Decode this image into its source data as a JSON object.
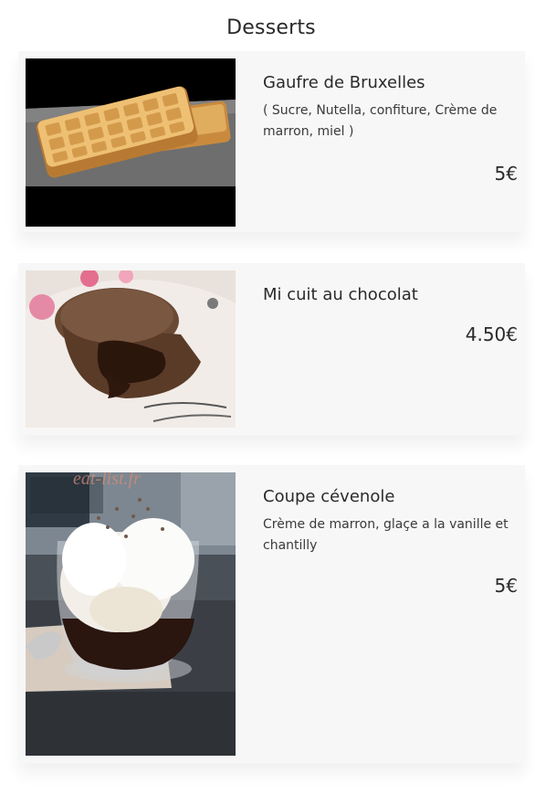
{
  "page": {
    "title": "Desserts"
  },
  "items": [
    {
      "name": "Gaufre de Bruxelles",
      "description": "( Sucre, Nutella, confiture, Crème de marron, miel )",
      "price": "5€",
      "image": "waffle-photo"
    },
    {
      "name": "Mi cuit au chocolat",
      "description": "",
      "price": "4.50€",
      "image": "chocolate-lava-cake-photo"
    },
    {
      "name": "Coupe cévenole",
      "description": "Crème de marron, glaçe a la vanille et chantilly",
      "price": "5€",
      "image": "ice-cream-sundae-photo",
      "watermark": "eat-list.fr"
    }
  ],
  "colors": {
    "card_background": "#f7f7f7",
    "text": "#2a2a2a"
  }
}
